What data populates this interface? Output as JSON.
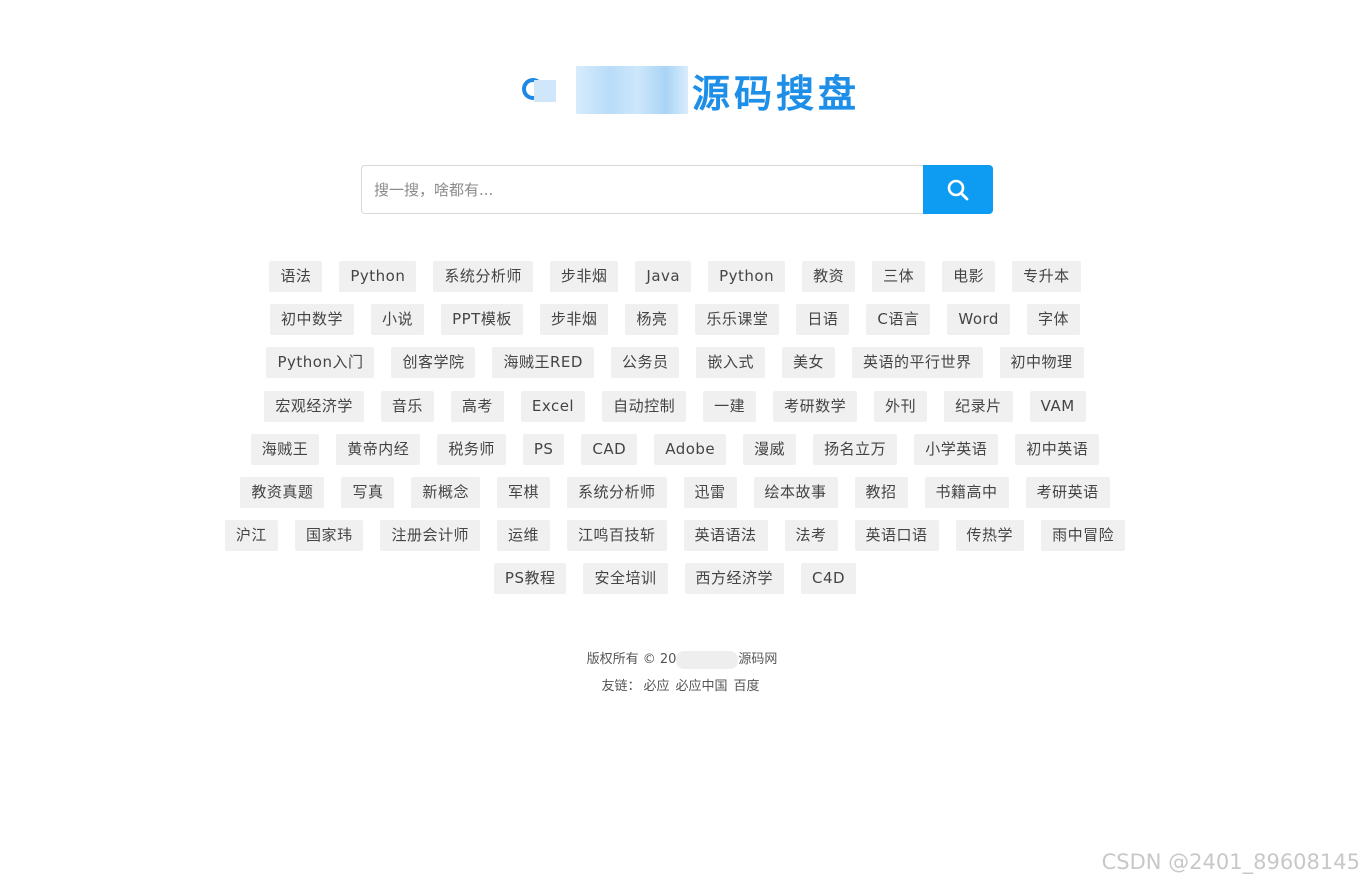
{
  "logo": {
    "text": "源码搜盘",
    "brand_color": "#1e8fe8"
  },
  "search": {
    "placeholder": "搜一搜，啥都有...",
    "value": "",
    "button_icon": "search-icon",
    "button_color": "#0d9cf2"
  },
  "tag_rows": [
    [
      "语法",
      "Python",
      "系统分析师",
      "步非烟",
      "Java",
      "Python",
      "教资",
      "三体",
      "电影",
      "专升本"
    ],
    [
      "初中数学",
      "小说",
      "PPT模板",
      "步非烟",
      "杨亮",
      "乐乐课堂",
      "日语",
      "C语言",
      "Word",
      "字体"
    ],
    [
      "Python入门",
      "创客学院",
      "海贼王RED",
      "公务员",
      "嵌入式",
      "美女",
      "英语的平行世界",
      "初中物理"
    ],
    [
      "宏观经济学",
      "音乐",
      "高考",
      "Excel",
      "自动控制",
      "一建",
      "考研数学",
      "外刊",
      "纪录片",
      "VAM"
    ],
    [
      "海贼王",
      "黄帝内经",
      "税务师",
      "PS",
      "CAD",
      "Adobe",
      "漫威",
      "扬名立万",
      "小学英语",
      "初中英语"
    ],
    [
      "教资真题",
      "写真",
      "新概念",
      "军棋",
      "系统分析师",
      "迅雷",
      "绘本故事",
      "教招",
      "书籍高中",
      "考研英语"
    ],
    [
      "沪江",
      "国家玮",
      "注册会计师",
      "运维",
      "江鸣百技斩",
      "英语语法",
      "法考",
      "英语口语",
      "传热学",
      "雨中冒险"
    ],
    [
      "PS教程",
      "安全培训",
      "西方经济学",
      "C4D"
    ]
  ],
  "footer": {
    "copyright_prefix": "版权所有 © 20",
    "copyright_suffix": "源码网",
    "links_label": "友链：",
    "links": [
      "必应",
      "必应中国",
      "百度"
    ]
  },
  "watermark": "CSDN @2401_89608145"
}
